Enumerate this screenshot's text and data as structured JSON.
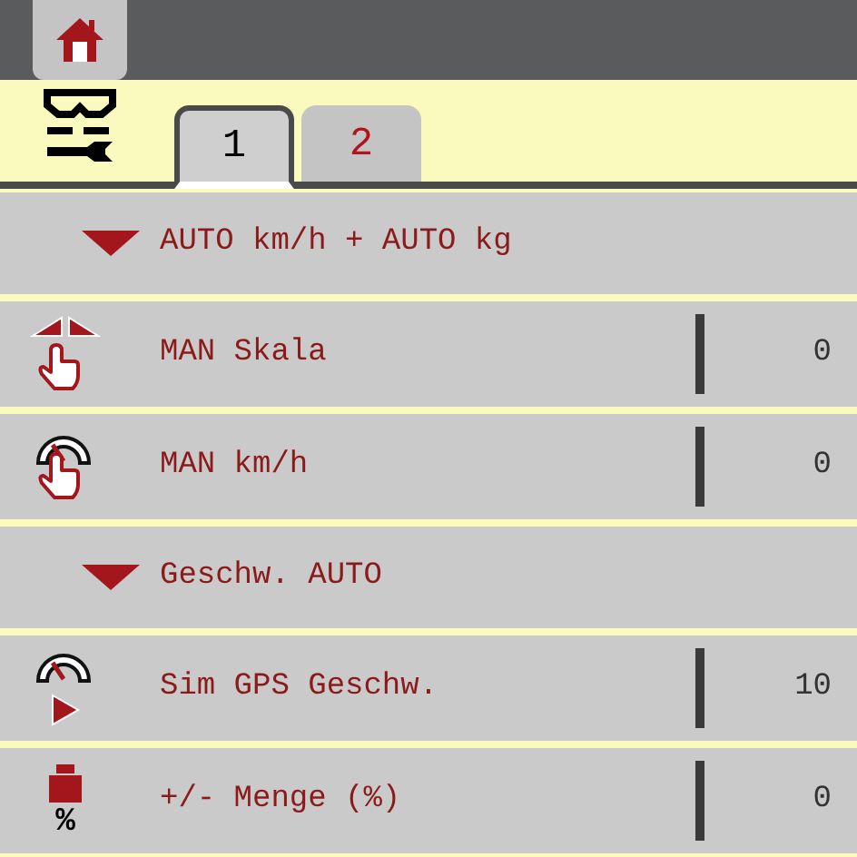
{
  "tabs": [
    {
      "label": "1",
      "selected": true
    },
    {
      "label": "2",
      "selected": false
    }
  ],
  "rows": [
    {
      "kind": "header",
      "label": "AUTO km/h + AUTO kg"
    },
    {
      "kind": "setting",
      "label": "MAN Skala",
      "value": "0"
    },
    {
      "kind": "setting",
      "label": "MAN km/h",
      "value": "0"
    },
    {
      "kind": "header",
      "label": "Geschw. AUTO"
    },
    {
      "kind": "setting",
      "label": "Sim GPS Geschw.",
      "value": "10"
    },
    {
      "kind": "setting",
      "icon_text": "%",
      "label": "+/- Menge (%)",
      "value": "0"
    }
  ]
}
